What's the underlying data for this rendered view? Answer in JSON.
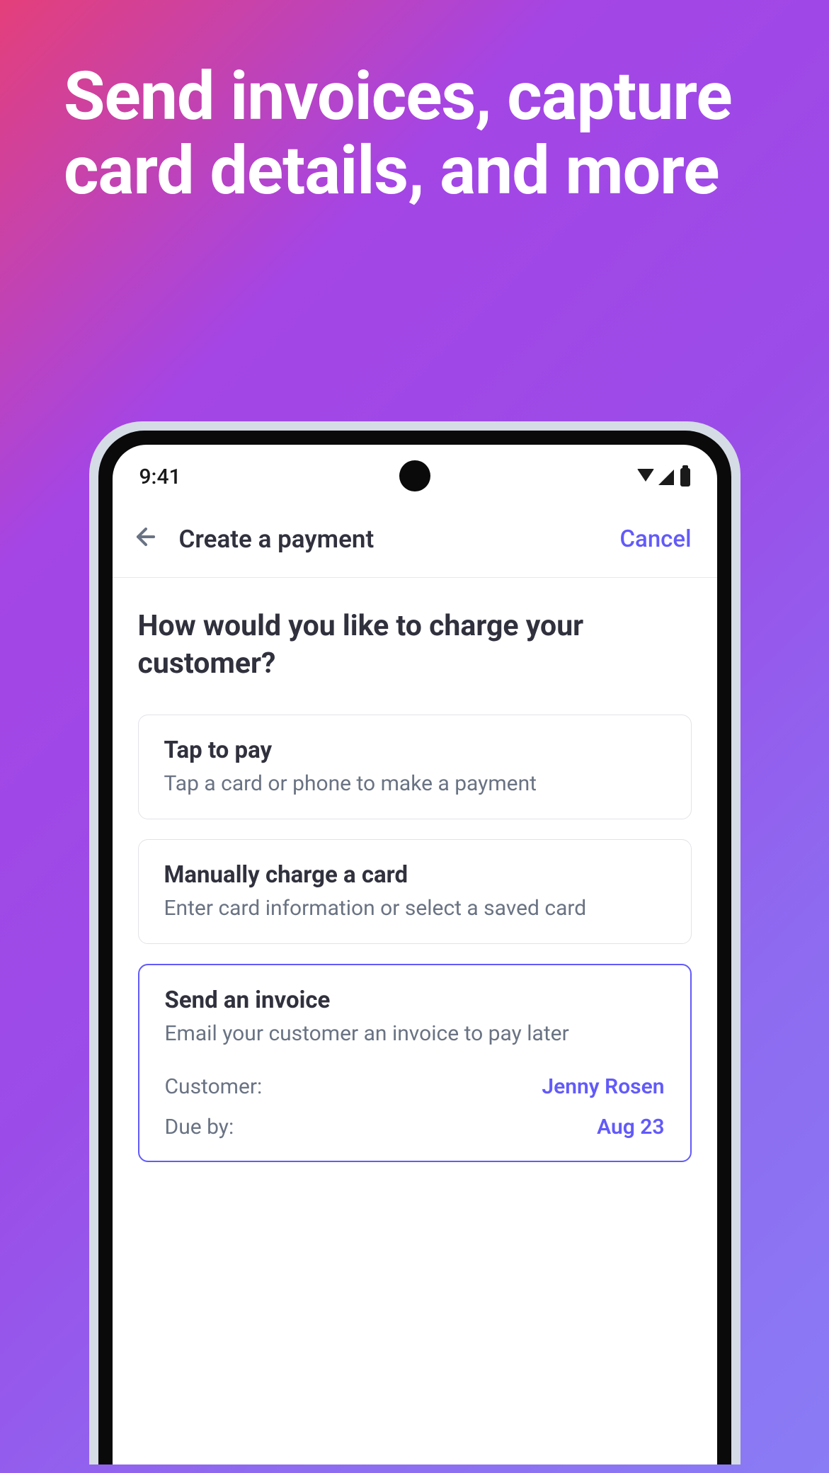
{
  "hero": {
    "text": "Send invoices, capture card details, and more"
  },
  "statusBar": {
    "time": "9:41"
  },
  "header": {
    "title": "Create a payment",
    "cancel": "Cancel"
  },
  "content": {
    "question": "How would you like to charge your customer?"
  },
  "options": [
    {
      "title": "Tap to pay",
      "subtitle": "Tap a card or phone to make a payment",
      "selected": false
    },
    {
      "title": "Manually charge a card",
      "subtitle": "Enter card information or select a saved card",
      "selected": false
    },
    {
      "title": "Send an invoice",
      "subtitle": "Email your customer an invoice to pay later",
      "selected": true
    }
  ],
  "invoiceDetails": {
    "customerLabel": "Customer:",
    "customerValue": "Jenny Rosen",
    "dueLabel": "Due by:",
    "dueValue": "Aug 23"
  }
}
